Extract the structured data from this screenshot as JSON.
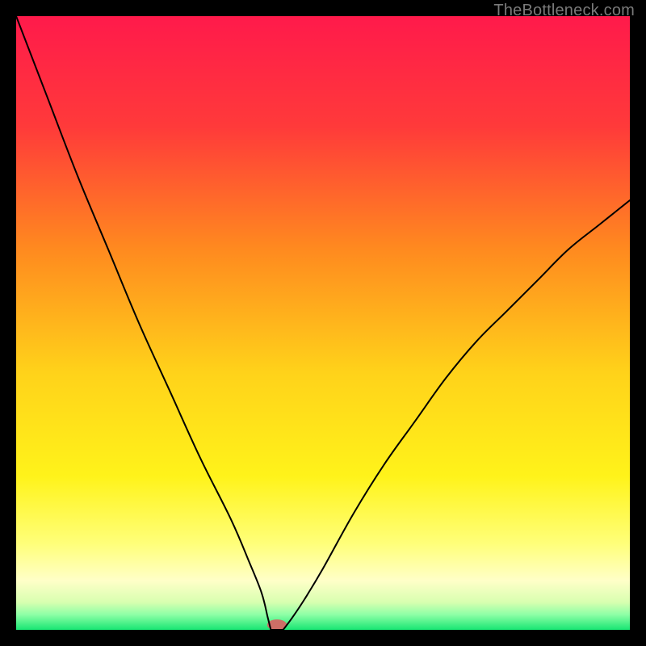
{
  "watermark": "TheBottleneck.com",
  "chart_data": {
    "type": "line",
    "title": "",
    "xlabel": "",
    "ylabel": "",
    "xlim": [
      0,
      100
    ],
    "ylim": [
      0,
      100
    ],
    "grid": false,
    "legend": false,
    "note": "Axes have no visible tick labels or titles; values estimated from plot geometry (0–100 normalized).",
    "series": [
      {
        "name": "left-branch",
        "x": [
          0,
          5,
          10,
          15,
          20,
          25,
          30,
          35,
          38,
          40,
          41,
          41.5
        ],
        "y": [
          100,
          87,
          74,
          62,
          50,
          39,
          28,
          18,
          11,
          6,
          2,
          0
        ]
      },
      {
        "name": "right-branch",
        "x": [
          43.5,
          45,
          47,
          50,
          55,
          60,
          65,
          70,
          75,
          80,
          85,
          90,
          95,
          100
        ],
        "y": [
          0,
          2,
          5,
          10,
          19,
          27,
          34,
          41,
          47,
          52,
          57,
          62,
          66,
          70
        ]
      }
    ],
    "marker": {
      "name": "min-marker",
      "cx": 42.5,
      "cy": 0.8,
      "rx": 1.6,
      "ry": 0.9,
      "color": "#cc6e66"
    },
    "gradient_stops": [
      {
        "offset": 0.0,
        "color": "#ff1a4b"
      },
      {
        "offset": 0.18,
        "color": "#ff3a3a"
      },
      {
        "offset": 0.38,
        "color": "#ff8a1f"
      },
      {
        "offset": 0.58,
        "color": "#ffd21a"
      },
      {
        "offset": 0.75,
        "color": "#fff31a"
      },
      {
        "offset": 0.86,
        "color": "#ffff7a"
      },
      {
        "offset": 0.92,
        "color": "#ffffc8"
      },
      {
        "offset": 0.955,
        "color": "#d8ffb0"
      },
      {
        "offset": 0.975,
        "color": "#8effa6"
      },
      {
        "offset": 1.0,
        "color": "#18e673"
      }
    ],
    "line_color": "#000000",
    "line_width": 2
  }
}
